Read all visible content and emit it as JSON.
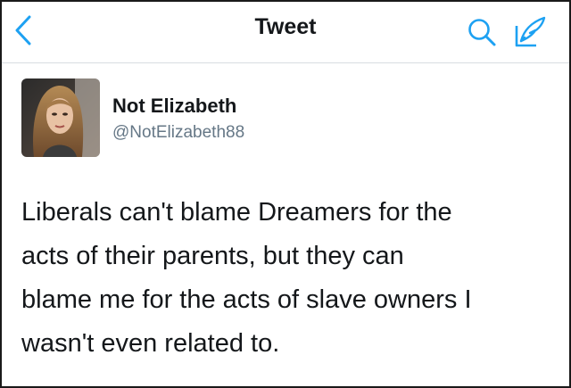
{
  "navbar": {
    "title": "Tweet",
    "back_icon": "chevron-left-icon",
    "search_icon": "search-icon",
    "compose_icon": "compose-icon",
    "accent_color": "#1da1f2"
  },
  "tweet": {
    "author": {
      "name": "Not Elizabeth",
      "handle": "@NotElizabeth88",
      "avatar_icon": "profile-photo"
    },
    "text": "Liberals can't blame Dreamers for the\nacts of their parents, but they can\nblame me for the acts of slave owners I\nwasn't even related to."
  }
}
